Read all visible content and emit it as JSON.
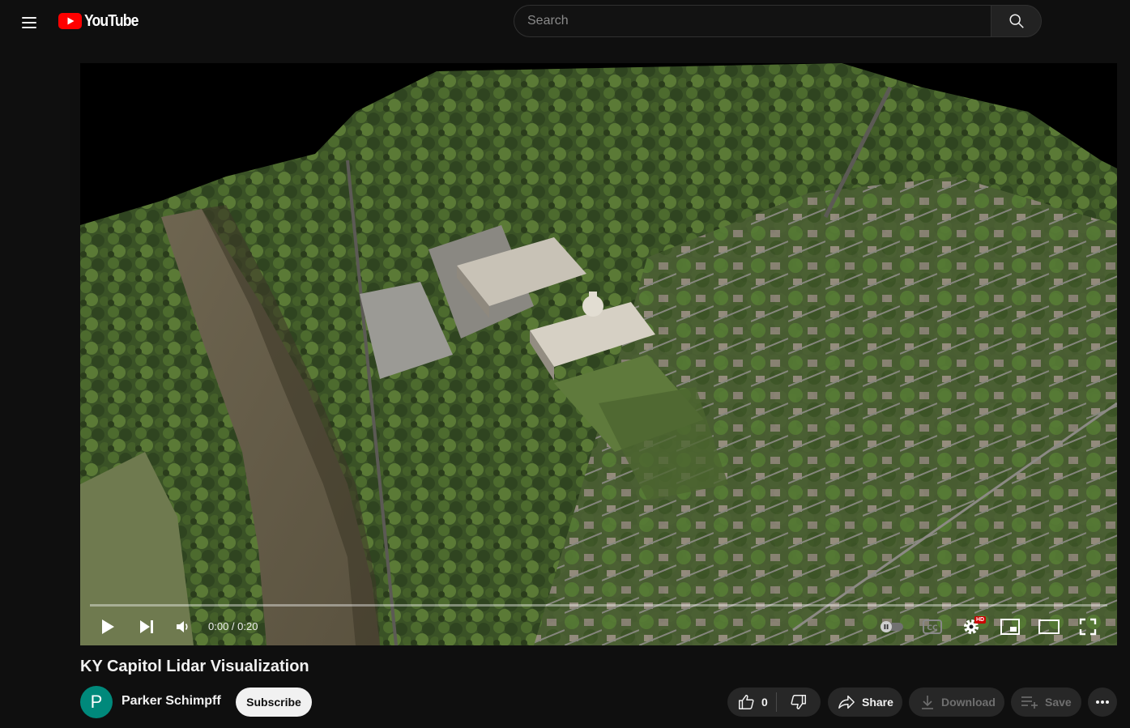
{
  "header": {
    "logo_text": "YouTube",
    "search_placeholder": "Search"
  },
  "player": {
    "time_display": "0:00 / 0:20",
    "progress_fraction": 0.0
  },
  "video": {
    "title": "KY Capitol Lidar Visualization"
  },
  "channel": {
    "avatar_letter": "P",
    "name": "Parker Schimpff",
    "subscribe_label": "Subscribe"
  },
  "actions": {
    "like_count": "0",
    "share_label": "Share",
    "download_label": "Download",
    "save_label": "Save"
  },
  "colors": {
    "background": "#0f0f0f",
    "brand_red": "#ff0000",
    "avatar_bg": "#00897b",
    "pill_bg": "#272727"
  },
  "icons": [
    "menu-icon",
    "youtube-logo-icon",
    "search-icon",
    "play-icon",
    "next-icon",
    "volume-icon",
    "autoplay-toggle-icon",
    "captions-icon",
    "settings-icon",
    "miniplayer-icon",
    "theater-mode-icon",
    "fullscreen-icon",
    "like-icon",
    "dislike-icon",
    "share-icon",
    "download-icon",
    "save-playlist-icon",
    "more-icon"
  ]
}
